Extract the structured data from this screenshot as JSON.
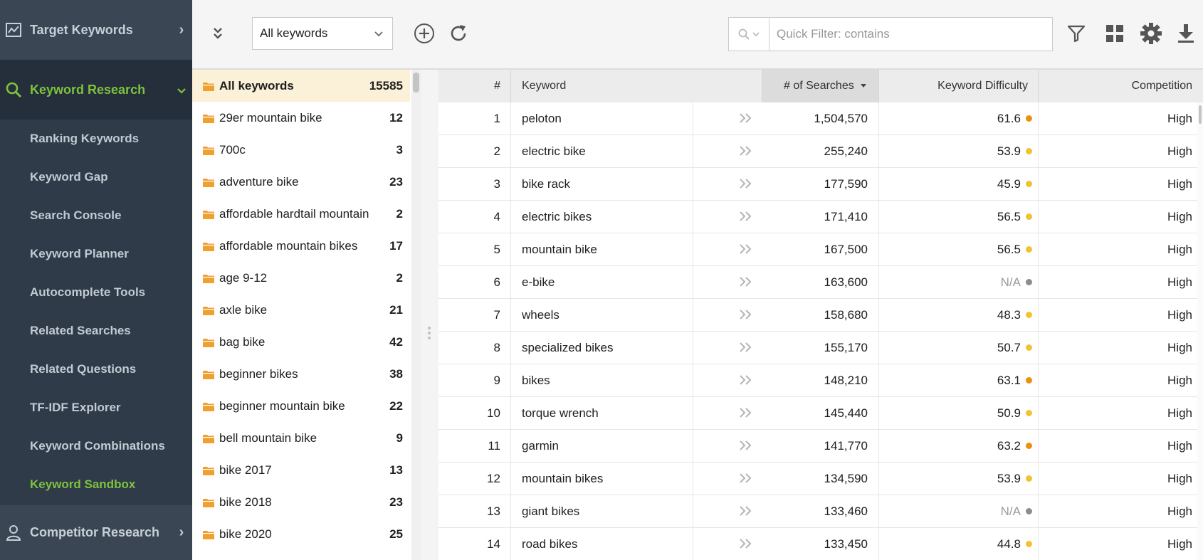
{
  "sidebar": {
    "target_keywords": "Target Keywords",
    "keyword_research": "Keyword Research",
    "items": [
      {
        "label": "Ranking Keywords",
        "active": false
      },
      {
        "label": "Keyword Gap",
        "active": false
      },
      {
        "label": "Search Console",
        "active": false
      },
      {
        "label": "Keyword Planner",
        "active": false
      },
      {
        "label": "Autocomplete Tools",
        "active": false
      },
      {
        "label": "Related Searches",
        "active": false
      },
      {
        "label": "Related Questions",
        "active": false
      },
      {
        "label": "TF-IDF Explorer",
        "active": false
      },
      {
        "label": "Keyword Combinations",
        "active": false
      },
      {
        "label": "Keyword Sandbox",
        "active": true
      }
    ],
    "competitor_research": "Competitor Research"
  },
  "toolbar": {
    "keyword_select_value": "All keywords",
    "quick_filter_placeholder": "Quick Filter: contains"
  },
  "folders": [
    {
      "name": "All keywords",
      "count": "15585",
      "selected": true
    },
    {
      "name": "29er mountain bike",
      "count": "12"
    },
    {
      "name": "700c",
      "count": "3"
    },
    {
      "name": "adventure bike",
      "count": "23"
    },
    {
      "name": "affordable hardtail mountain",
      "count": "2"
    },
    {
      "name": "affordable mountain bikes",
      "count": "17"
    },
    {
      "name": "age 9-12",
      "count": "2"
    },
    {
      "name": "axle bike",
      "count": "21"
    },
    {
      "name": "bag bike",
      "count": "42"
    },
    {
      "name": "beginner bikes",
      "count": "38"
    },
    {
      "name": "beginner mountain bike",
      "count": "22"
    },
    {
      "name": "bell mountain bike",
      "count": "9"
    },
    {
      "name": "bike 2017",
      "count": "13"
    },
    {
      "name": "bike 2018",
      "count": "23"
    },
    {
      "name": "bike 2020",
      "count": "25"
    }
  ],
  "table": {
    "columns": {
      "num": "#",
      "keyword": "Keyword",
      "searches": "# of Searches",
      "difficulty": "Keyword Difficulty",
      "competition": "Competition"
    },
    "colors": {
      "orange": "#e8920e",
      "yellow": "#f1c232",
      "gray": "#8c8c8c"
    },
    "rows": [
      {
        "num": "1",
        "keyword": "peloton",
        "searches": "1,504,570",
        "difficulty": "61.6",
        "dot": "orange",
        "competition": "High"
      },
      {
        "num": "2",
        "keyword": "electric bike",
        "searches": "255,240",
        "difficulty": "53.9",
        "dot": "yellow",
        "competition": "High"
      },
      {
        "num": "3",
        "keyword": "bike rack",
        "searches": "177,590",
        "difficulty": "45.9",
        "dot": "yellow",
        "competition": "High"
      },
      {
        "num": "4",
        "keyword": "electric bikes",
        "searches": "171,410",
        "difficulty": "56.5",
        "dot": "yellow",
        "competition": "High"
      },
      {
        "num": "5",
        "keyword": "mountain bike",
        "searches": "167,500",
        "difficulty": "56.5",
        "dot": "yellow",
        "competition": "High"
      },
      {
        "num": "6",
        "keyword": "e-bike",
        "searches": "163,600",
        "difficulty": "N/A",
        "dot": "gray",
        "competition": "High"
      },
      {
        "num": "7",
        "keyword": "wheels",
        "searches": "158,680",
        "difficulty": "48.3",
        "dot": "yellow",
        "competition": "High"
      },
      {
        "num": "8",
        "keyword": "specialized bikes",
        "searches": "155,170",
        "difficulty": "50.7",
        "dot": "yellow",
        "competition": "High"
      },
      {
        "num": "9",
        "keyword": "bikes",
        "searches": "148,210",
        "difficulty": "63.1",
        "dot": "orange",
        "competition": "High"
      },
      {
        "num": "10",
        "keyword": "torque wrench",
        "searches": "145,440",
        "difficulty": "50.9",
        "dot": "yellow",
        "competition": "High"
      },
      {
        "num": "11",
        "keyword": "garmin",
        "searches": "141,770",
        "difficulty": "63.2",
        "dot": "orange",
        "competition": "High"
      },
      {
        "num": "12",
        "keyword": "mountain bikes",
        "searches": "134,590",
        "difficulty": "53.9",
        "dot": "yellow",
        "competition": "High"
      },
      {
        "num": "13",
        "keyword": "giant bikes",
        "searches": "133,460",
        "difficulty": "N/A",
        "dot": "gray",
        "competition": "High"
      },
      {
        "num": "14",
        "keyword": "road bikes",
        "searches": "133,450",
        "difficulty": "44.8",
        "dot": "yellow",
        "competition": "High"
      }
    ]
  }
}
